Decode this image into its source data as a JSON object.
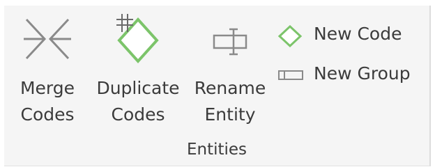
{
  "ribbon_group": {
    "label": "Entities",
    "buttons": {
      "merge": {
        "line1": "Merge",
        "line2": "Codes",
        "icon": "merge-arrows-icon"
      },
      "duplicate": {
        "line1": "Duplicate",
        "line2": "Codes",
        "icon": "duplicate-code-icon"
      },
      "rename": {
        "line1": "Rename",
        "line2": "Entity",
        "icon": "rename-entity-icon"
      },
      "new_code": {
        "label": "New Code",
        "icon": "new-code-diamond-icon"
      },
      "new_group": {
        "label": "New Group",
        "icon": "new-group-icon"
      }
    }
  },
  "colors": {
    "code_green": "#7cc46a",
    "icon_gray": "#7a7a7a",
    "ribbon_bg": "#f5f5f5"
  }
}
